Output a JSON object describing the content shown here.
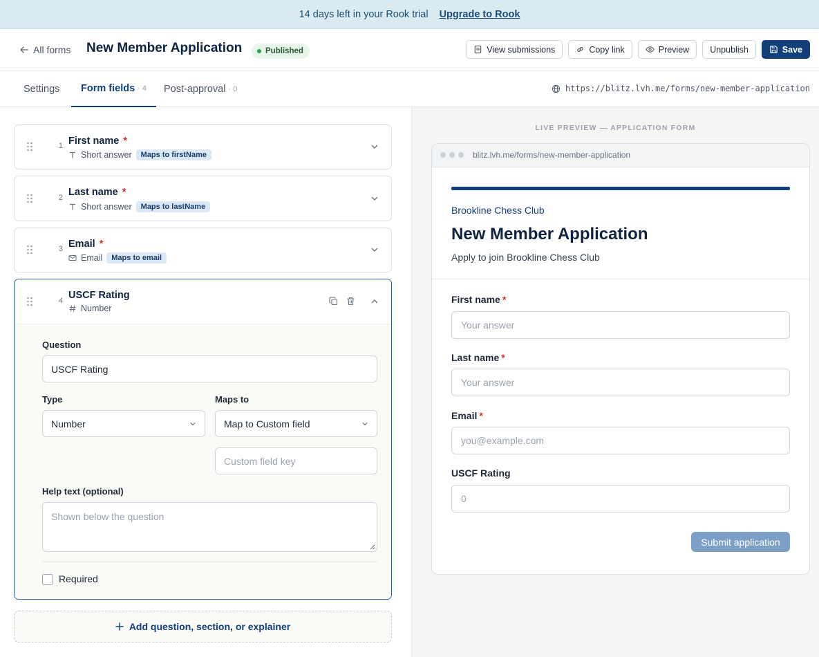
{
  "banner": {
    "text": "14 days left in your Rook trial",
    "link": "Upgrade to Rook"
  },
  "header": {
    "back_label": "All forms",
    "title": "New Member Application",
    "status": "Published",
    "actions": {
      "view_submissions": "View submissions",
      "copy_link": "Copy link",
      "preview": "Preview",
      "unpublish": "Unpublish",
      "save": "Save"
    }
  },
  "tabs": [
    {
      "label": "Settings",
      "count": ""
    },
    {
      "label": "Form fields",
      "count": "· 4",
      "active": true
    },
    {
      "label": "Post-approval",
      "count": "· 0"
    }
  ],
  "public_url": "https://blitz.lvh.me/forms/new-member-application",
  "fields": [
    {
      "number": "1",
      "label": "First name",
      "required_mark": "*",
      "type": "Short answer",
      "type_icon": "text-type-icon",
      "maps": "Maps to firstName"
    },
    {
      "number": "2",
      "label": "Last name",
      "required_mark": "*",
      "type": "Short answer",
      "type_icon": "text-type-icon",
      "maps": "Maps to lastName"
    },
    {
      "number": "3",
      "label": "Email",
      "required_mark": "*",
      "type": "Email",
      "type_icon": "mail-icon",
      "maps": "Maps to email"
    },
    {
      "number": "4",
      "label": "USCF Rating",
      "required_mark": "",
      "type": "Number",
      "type_icon": "hash-icon",
      "maps": ""
    }
  ],
  "editor": {
    "question_label": "Question",
    "question_value": "USCF Rating",
    "type_label": "Type",
    "type_value": "Number",
    "maps_label": "Maps to",
    "maps_value": "Map to Custom field",
    "custom_key_placeholder": "Custom field key",
    "help_label": "Help text (optional)",
    "help_placeholder": "Shown below the question",
    "required_label": "Required",
    "required_checked": false
  },
  "add_button": "Add question, section, or explainer",
  "preview": {
    "caption": "LIVE PREVIEW — APPLICATION FORM",
    "browser_url": "blitz.lvh.me/forms/new-member-application",
    "org": "Brookline Chess Club",
    "title": "New Member Application",
    "description": "Apply to join Brookline Chess Club",
    "fields": [
      {
        "label": "First name",
        "required_mark": "*",
        "placeholder": "Your answer"
      },
      {
        "label": "Last name",
        "required_mark": "*",
        "placeholder": "Your answer"
      },
      {
        "label": "Email",
        "required_mark": "*",
        "placeholder": "you@example.com"
      },
      {
        "label": "USCF Rating",
        "required_mark": "",
        "placeholder": "0"
      }
    ],
    "submit": "Submit application"
  },
  "colors": {
    "brand": "#123f7a",
    "required": "#d12b2b",
    "banner_bg": "#dbeaf1",
    "published": "#22a04b"
  }
}
